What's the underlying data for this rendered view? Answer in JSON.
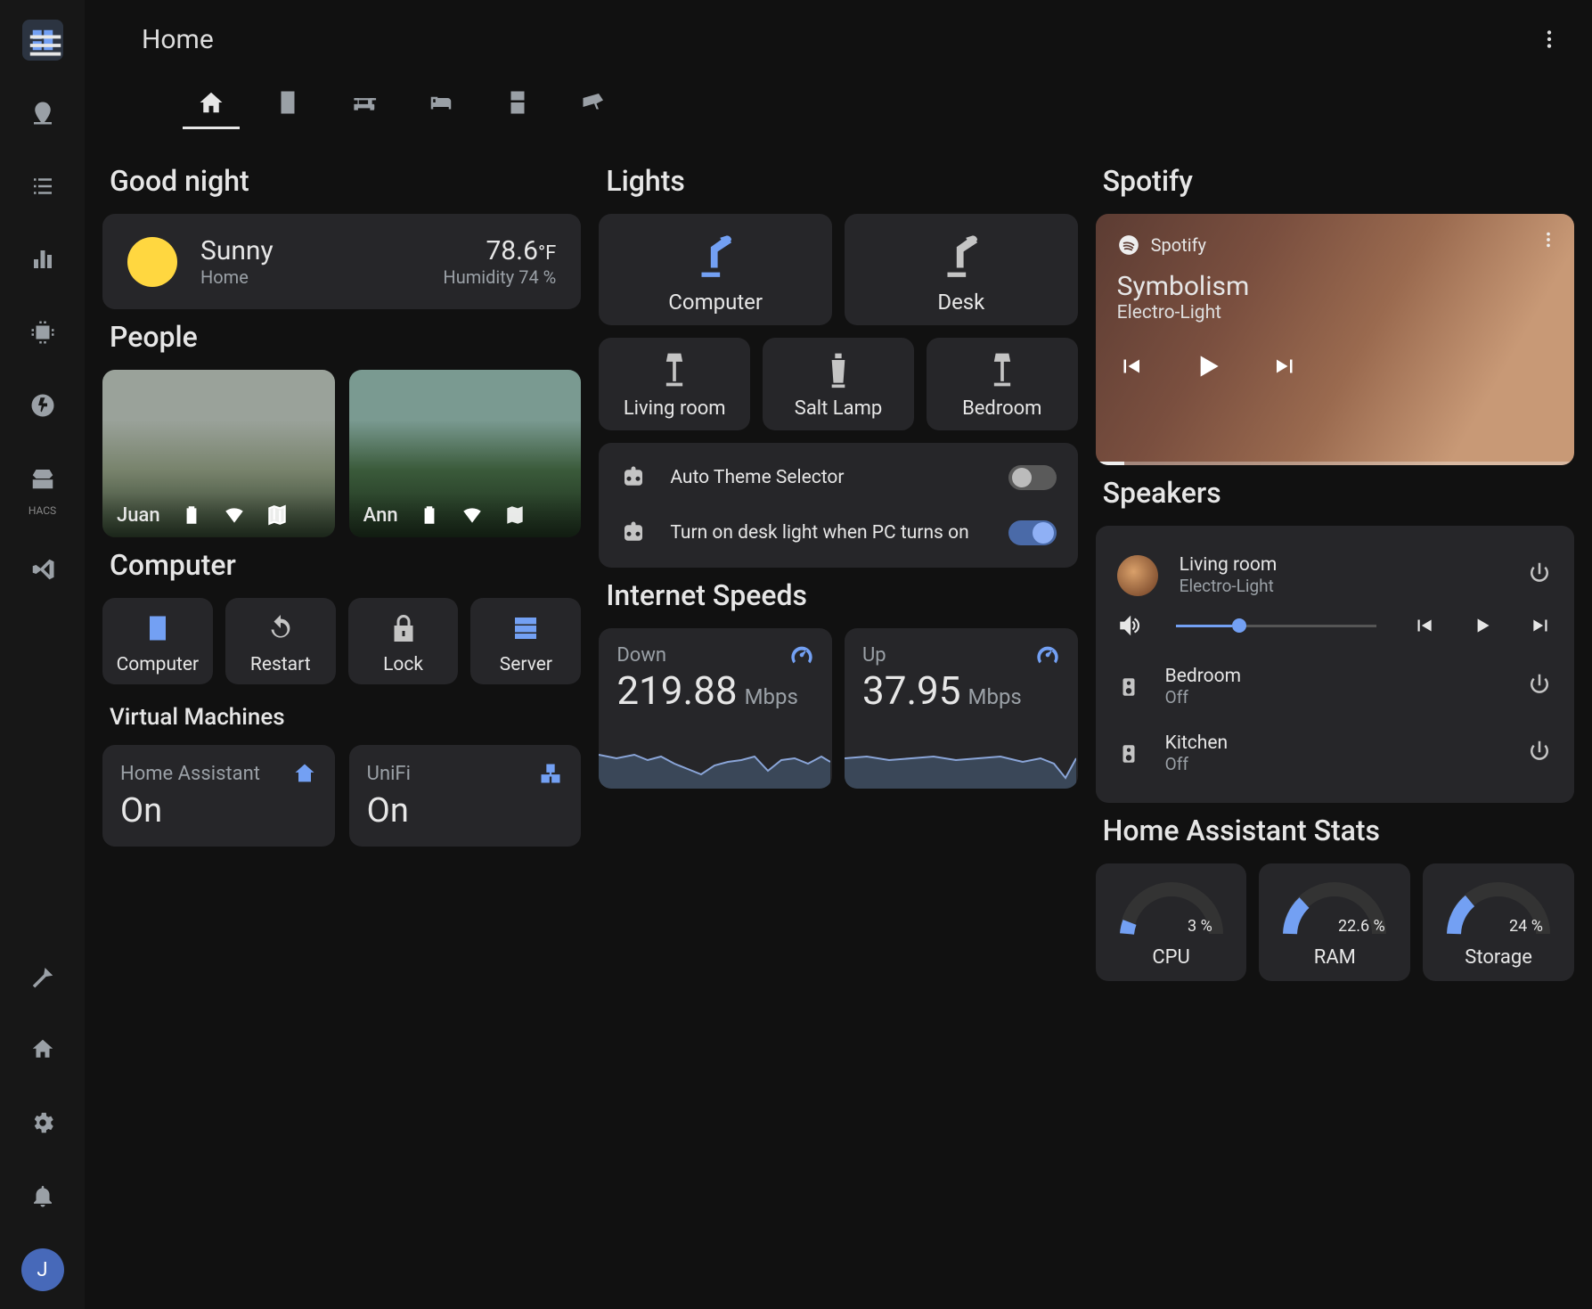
{
  "header": {
    "title": "Home"
  },
  "tabs": [
    "home",
    "server",
    "sofa",
    "bed",
    "fridge",
    "camera"
  ],
  "greeting": {
    "title": "Good night"
  },
  "weather": {
    "condition": "Sunny",
    "location": "Home",
    "temp": "78.6",
    "unit": "°F",
    "humidity": "Humidity 74 %"
  },
  "people_title": "People",
  "people": [
    {
      "name": "Juan"
    },
    {
      "name": "Ann"
    }
  ],
  "computer": {
    "title": "Computer",
    "actions": [
      {
        "label": "Computer",
        "icon": "pc",
        "on": true
      },
      {
        "label": "Restart",
        "icon": "restart",
        "on": false
      },
      {
        "label": "Lock",
        "icon": "lock",
        "on": false
      },
      {
        "label": "Server",
        "icon": "server",
        "on": true
      }
    ],
    "vm_title": "Virtual Machines",
    "vms": [
      {
        "name": "Home Assistant",
        "state": "On",
        "icon": "ha"
      },
      {
        "name": "UniFi",
        "state": "On",
        "icon": "net"
      }
    ]
  },
  "lights": {
    "title": "Lights",
    "top": [
      {
        "label": "Computer",
        "icon": "desklamp",
        "on": true
      },
      {
        "label": "Desk",
        "icon": "desklamp",
        "on": false
      }
    ],
    "bottom": [
      {
        "label": "Living room",
        "icon": "floorlamp",
        "on": false
      },
      {
        "label": "Salt Lamp",
        "icon": "lava",
        "on": false
      },
      {
        "label": "Bedroom",
        "icon": "floorlamp",
        "on": false
      }
    ],
    "automations": [
      {
        "label": "Auto Theme Selector",
        "on": false
      },
      {
        "label": "Turn on desk light when PC turns on",
        "on": true
      }
    ]
  },
  "internet": {
    "title": "Internet Speeds",
    "down": {
      "label": "Down",
      "value": "219.88",
      "unit": "Mbps"
    },
    "up": {
      "label": "Up",
      "value": "37.95",
      "unit": "Mbps"
    }
  },
  "spotify": {
    "title": "Spotify",
    "app": "Spotify",
    "track": "Symbolism",
    "artist": "Electro-Light"
  },
  "speakers": {
    "title": "Speakers",
    "items": [
      {
        "name": "Living room",
        "sub": "Electro-Light",
        "playing": true
      },
      {
        "name": "Bedroom",
        "sub": "Off",
        "playing": false
      },
      {
        "name": "Kitchen",
        "sub": "Off",
        "playing": false
      }
    ]
  },
  "stats": {
    "title": "Home Assistant Stats",
    "gauges": [
      {
        "label": "CPU",
        "value": "3 %",
        "pct": 3
      },
      {
        "label": "RAM",
        "value": "22.6 %",
        "pct": 22.6
      },
      {
        "label": "Storage",
        "value": "24 %",
        "pct": 24
      }
    ]
  },
  "rail_avatar": "J"
}
